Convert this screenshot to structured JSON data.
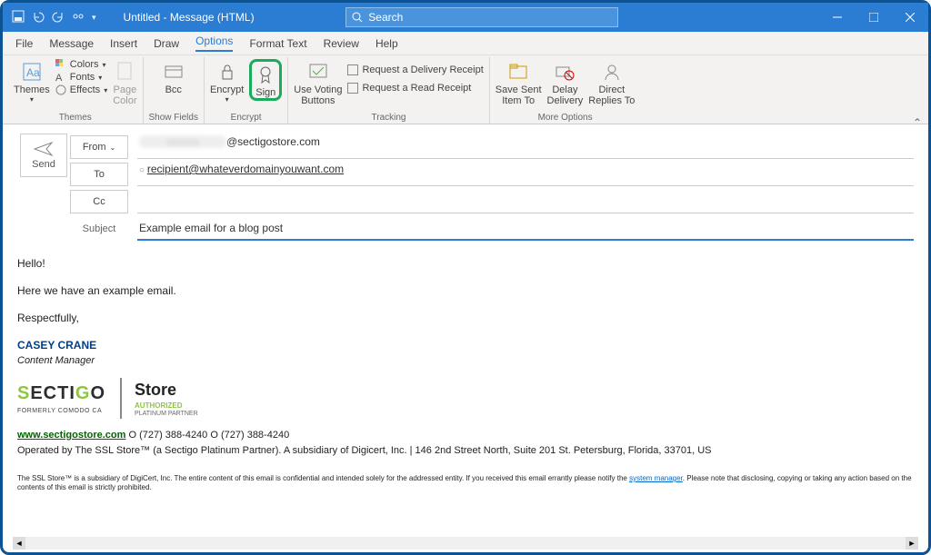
{
  "window": {
    "title": "Untitled  -  Message (HTML)",
    "search_placeholder": "Search"
  },
  "menu": {
    "file": "File",
    "message": "Message",
    "insert": "Insert",
    "draw": "Draw",
    "options": "Options",
    "format": "Format Text",
    "review": "Review",
    "help": "Help"
  },
  "ribbon": {
    "themes": {
      "label": "Themes",
      "themes": "Themes",
      "colors": "Colors",
      "fonts": "Fonts",
      "effects": "Effects",
      "pagecolor": "Page\nColor"
    },
    "showfields": {
      "label": "Show Fields",
      "bcc": "Bcc"
    },
    "encrypt": {
      "label": "Encrypt",
      "encrypt": "Encrypt",
      "sign": "Sign"
    },
    "voting": "Use Voting\nButtons",
    "tracking": {
      "label": "Tracking",
      "delivery": "Request a Delivery Receipt",
      "read": "Request a Read Receipt"
    },
    "more": {
      "label": "More Options",
      "savesent": "Save Sent\nItem To",
      "delay": "Delay\nDelivery",
      "direct": "Direct\nReplies To"
    }
  },
  "compose": {
    "send": "Send",
    "from_btn": "From",
    "from_value": "@sectigostore.com",
    "to_btn": "To",
    "to_value": "recipient@whateverdomainyouwant.com",
    "cc_btn": "Cc",
    "cc_value": "",
    "subject_label": "Subject",
    "subject_value": "Example email for a blog post"
  },
  "bodytext": {
    "line1": "Hello!",
    "line2": "Here we have an example email.",
    "line3": "Respectfully,",
    "sig_name": "CASEY CRANE",
    "sig_title": "Content Manager",
    "sectigo": "SECTIGO",
    "sectigo_sub": "FORMERLY COMODO CA",
    "store": "Store",
    "store_auth": "AUTHORIZED",
    "store_plat": "PLATINUM PARTNER",
    "url": "www.sectigostore.com",
    "phones": " O (727) 388-4240 O (727) 388-4240",
    "oper": "Operated by The SSL Store™ (a Sectigo Platinum Partner).   A subsidiary of Digicert, Inc. | 146 2nd Street North, Suite 201 St. Petersburg, Florida, 33701, US",
    "disc_pre": "The SSL Store™ is a subsidiary of DigiCert, Inc. The entire content of this email is confidential and intended solely for the addressed entity. If you received this email errantly please notify the ",
    "disc_link": "system manager",
    "disc_post": ". Please note that disclosing, copying or taking any action based on the contents of this email is strictly prohibited."
  }
}
